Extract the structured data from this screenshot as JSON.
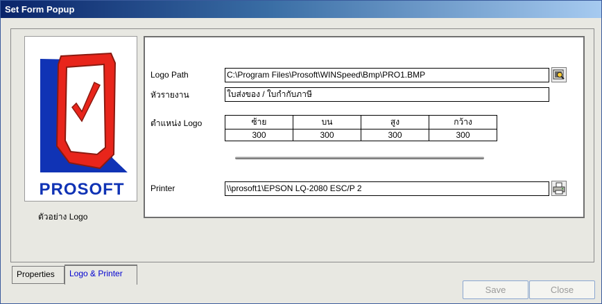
{
  "window": {
    "title": "Set Form Popup"
  },
  "logo_preview": {
    "caption": "ตัวอย่าง Logo",
    "brand_text": "PROSOFT"
  },
  "form": {
    "logo_path": {
      "label": "Logo Path",
      "value": "C:\\Program Files\\Prosoft\\WINSpeed\\Bmp\\PRO1.BMP"
    },
    "report_header": {
      "label": "หัวรายงาน",
      "value": "ใบส่งของ / ใบกำกับภาษี"
    },
    "logo_position": {
      "label": "ตำแหน่ง Logo",
      "columns": [
        "ซ้าย",
        "บน",
        "สูง",
        "กว้าง"
      ],
      "values": [
        "300",
        "300",
        "300",
        "300"
      ]
    },
    "printer": {
      "label": "Printer",
      "value": "\\\\prosoft1\\EPSON LQ-2080 ESC/P 2"
    }
  },
  "tabs": [
    {
      "label": "Properties",
      "active": false
    },
    {
      "label": "Logo & Printer",
      "active": true
    }
  ],
  "buttons": {
    "save": "Save",
    "close": "Close"
  },
  "colors": {
    "title_start": "#0a246a",
    "title_end": "#a6caf0",
    "active_tab_text": "#0000d0",
    "logo_red": "#e8251b",
    "logo_blue": "#1033b5"
  }
}
